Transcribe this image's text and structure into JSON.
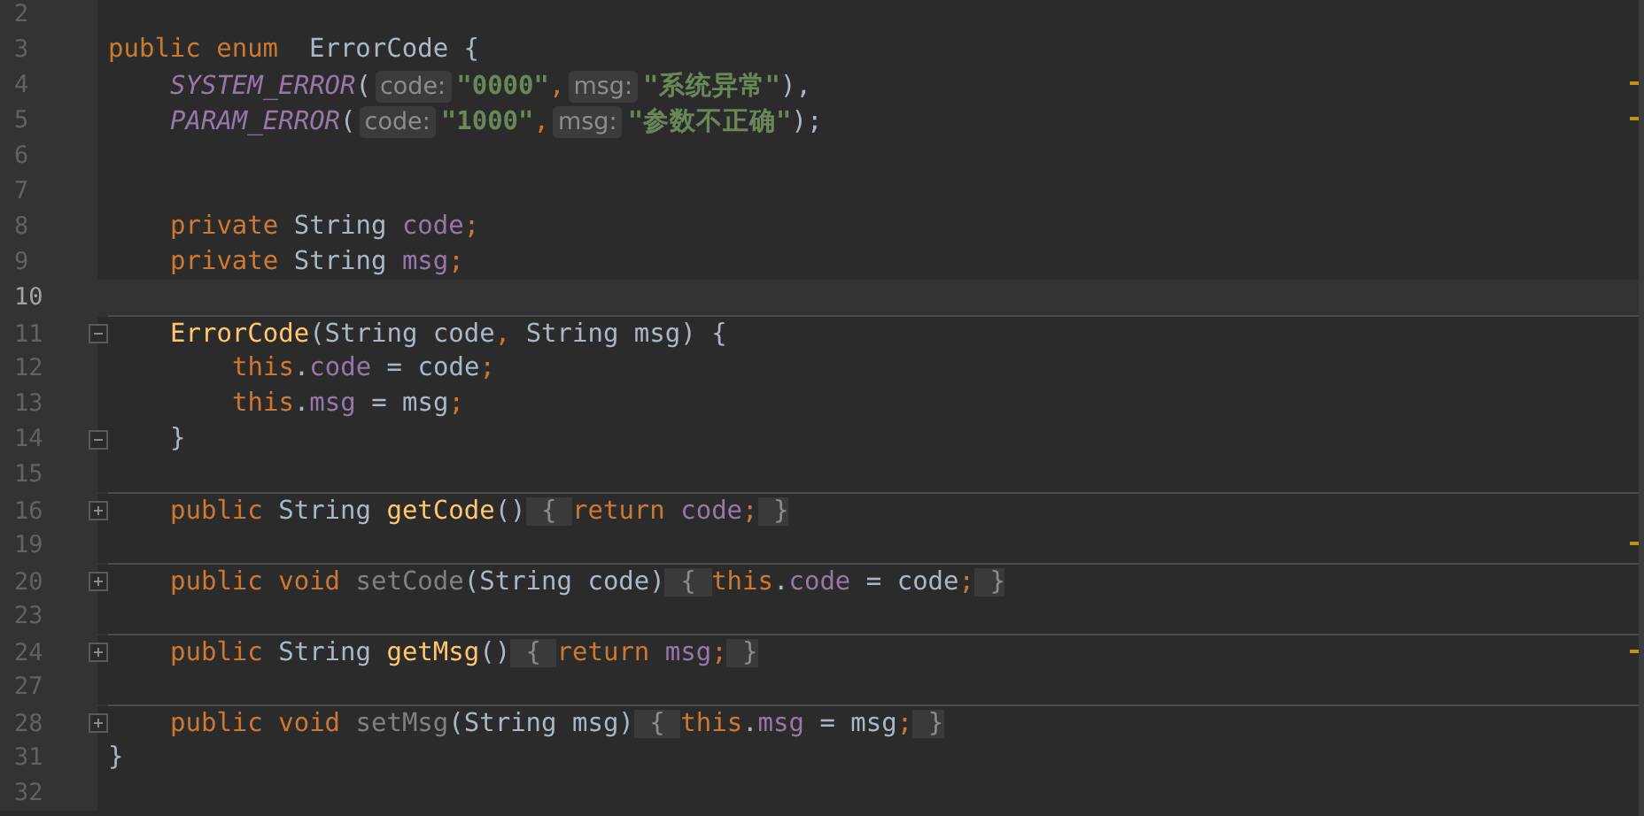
{
  "lines": [
    {
      "number": "2",
      "current": false,
      "separator_above": false,
      "marker": false
    },
    {
      "number": "3",
      "current": false,
      "separator_above": false,
      "marker": false,
      "tokens": [
        {
          "kind": "keyword",
          "text": "public enum"
        },
        {
          "kind": "plain",
          "text": "  ErrorCode {"
        }
      ],
      "children": [
        {
          "number": "4",
          "current": false,
          "separator_above": false,
          "marker": true,
          "tokens": [
            {
              "kind": "constant",
              "text": "SYSTEM_ERROR"
            },
            {
              "kind": "plain",
              "text": "("
            },
            {
              "kind": "hint",
              "text": "code:"
            },
            {
              "kind": "string",
              "text": "\"0000\""
            },
            {
              "kind": "keyword",
              "text": ","
            },
            {
              "kind": "hint",
              "text": "msg:"
            },
            {
              "kind": "string",
              "text": "\"系统异常\""
            },
            {
              "kind": "plain",
              "text": "),"
            }
          ]
        },
        {
          "number": "5",
          "current": false,
          "separator_above": false,
          "marker": true,
          "tokens": [
            {
              "kind": "constant",
              "text": "PARAM_ERROR"
            },
            {
              "kind": "plain",
              "text": "("
            },
            {
              "kind": "hint",
              "text": "code:"
            },
            {
              "kind": "string",
              "text": "\"1000\""
            },
            {
              "kind": "keyword",
              "text": ","
            },
            {
              "kind": "hint",
              "text": "msg:"
            },
            {
              "kind": "string",
              "text": "\"参数不正确\""
            },
            {
              "kind": "plain",
              "text": ");"
            }
          ]
        },
        {
          "number": "6",
          "current": false,
          "separator_above": false,
          "marker": false
        },
        {
          "number": "7",
          "current": false,
          "separator_above": false,
          "marker": false
        },
        {
          "number": "8",
          "current": false,
          "separator_above": false,
          "marker": false,
          "tokens": [
            {
              "kind": "keyword",
              "text": "private "
            },
            {
              "kind": "plain",
              "text": "String "
            },
            {
              "kind": "field",
              "text": "code"
            },
            {
              "kind": "keyword",
              "text": ";"
            }
          ]
        },
        {
          "number": "9",
          "current": false,
          "separator_above": false,
          "marker": false,
          "tokens": [
            {
              "kind": "keyword",
              "text": "private "
            },
            {
              "kind": "plain",
              "text": "String "
            },
            {
              "kind": "field",
              "text": "msg"
            },
            {
              "kind": "keyword",
              "text": ";"
            }
          ]
        },
        {
          "number": "10",
          "current": true,
          "separator_above": false,
          "marker": false
        },
        {
          "number": "11",
          "current": false,
          "separator_above": true,
          "marker": false,
          "fold": {
            "kind": "start"
          },
          "tokens": [
            {
              "kind": "method",
              "text": "ErrorCode"
            },
            {
              "kind": "plain",
              "text": "(String code"
            },
            {
              "kind": "keyword",
              "text": ", "
            },
            {
              "kind": "plain",
              "text": "String msg) {"
            }
          ],
          "children": [
            {
              "number": "12",
              "current": false,
              "separator_above": false,
              "marker": false,
              "tokens": [
                {
                  "kind": "keyword",
                  "text": "this"
                },
                {
                  "kind": "plain",
                  "text": "."
                },
                {
                  "kind": "field",
                  "text": "code"
                },
                {
                  "kind": "plain",
                  "text": " = code"
                },
                {
                  "kind": "keyword",
                  "text": ";"
                }
              ]
            },
            {
              "number": "13",
              "current": false,
              "separator_above": false,
              "marker": false,
              "tokens": [
                {
                  "kind": "keyword",
                  "text": "this"
                },
                {
                  "kind": "plain",
                  "text": "."
                },
                {
                  "kind": "field",
                  "text": "msg"
                },
                {
                  "kind": "plain",
                  "text": " = msg"
                },
                {
                  "kind": "keyword",
                  "text": ";"
                }
              ]
            }
          ]
        },
        {
          "number": "14",
          "current": false,
          "separator_above": false,
          "marker": false,
          "fold": {
            "kind": "end"
          },
          "tokens": [
            {
              "kind": "plain",
              "text": "}"
            }
          ]
        },
        {
          "number": "15",
          "current": false,
          "separator_above": false,
          "marker": false
        },
        {
          "number": "16",
          "current": false,
          "separator_above": true,
          "marker": false,
          "fold": {
            "kind": "collapsed"
          },
          "tokens": [
            {
              "kind": "keyword",
              "text": "public "
            },
            {
              "kind": "plain",
              "text": "String "
            },
            {
              "kind": "method",
              "text": "getCode"
            },
            {
              "kind": "plain",
              "text": "()"
            },
            {
              "kind": "folded",
              "text": " { "
            },
            {
              "kind": "keyword",
              "text": "return "
            },
            {
              "kind": "field",
              "text": "code"
            },
            {
              "kind": "keyword",
              "text": ";"
            },
            {
              "kind": "folded",
              "text": " }"
            }
          ]
        },
        {
          "number": "19",
          "current": false,
          "separator_above": false,
          "marker": true
        },
        {
          "number": "20",
          "current": false,
          "separator_above": true,
          "marker": false,
          "fold": {
            "kind": "collapsed"
          },
          "tokens": [
            {
              "kind": "keyword",
              "text": "public void "
            },
            {
              "kind": "unused",
              "text": "setCode"
            },
            {
              "kind": "plain",
              "text": "(String code)"
            },
            {
              "kind": "folded",
              "text": " { "
            },
            {
              "kind": "keyword",
              "text": "this"
            },
            {
              "kind": "plain",
              "text": "."
            },
            {
              "kind": "field",
              "text": "code"
            },
            {
              "kind": "plain",
              "text": " = code"
            },
            {
              "kind": "keyword",
              "text": ";"
            },
            {
              "kind": "folded",
              "text": " }"
            }
          ]
        },
        {
          "number": "23",
          "current": false,
          "separator_above": false,
          "marker": false
        },
        {
          "number": "24",
          "current": false,
          "separator_above": true,
          "marker": true,
          "fold": {
            "kind": "collapsed"
          },
          "tokens": [
            {
              "kind": "keyword",
              "text": "public "
            },
            {
              "kind": "plain",
              "text": "String "
            },
            {
              "kind": "method",
              "text": "getMsg"
            },
            {
              "kind": "plain",
              "text": "()"
            },
            {
              "kind": "folded",
              "text": " { "
            },
            {
              "kind": "keyword",
              "text": "return "
            },
            {
              "kind": "field",
              "text": "msg"
            },
            {
              "kind": "keyword",
              "text": ";"
            },
            {
              "kind": "folded",
              "text": " }"
            }
          ]
        },
        {
          "number": "27",
          "current": false,
          "separator_above": false,
          "marker": false
        },
        {
          "number": "28",
          "current": false,
          "separator_above": true,
          "marker": false,
          "fold": {
            "kind": "collapsed"
          },
          "tokens": [
            {
              "kind": "keyword",
              "text": "public void "
            },
            {
              "kind": "unused",
              "text": "setMsg"
            },
            {
              "kind": "plain",
              "text": "(String msg)"
            },
            {
              "kind": "folded",
              "text": " { "
            },
            {
              "kind": "keyword",
              "text": "this"
            },
            {
              "kind": "plain",
              "text": "."
            },
            {
              "kind": "field",
              "text": "msg"
            },
            {
              "kind": "plain",
              "text": " = msg"
            },
            {
              "kind": "keyword",
              "text": ";"
            },
            {
              "kind": "folded",
              "text": " }"
            }
          ]
        }
      ]
    },
    {
      "number": "31",
      "current": false,
      "separator_above": false,
      "marker": false,
      "tokens": [
        {
          "kind": "plain",
          "text": "}"
        }
      ]
    },
    {
      "number": "32",
      "current": false,
      "separator_above": false,
      "marker": false
    }
  ]
}
